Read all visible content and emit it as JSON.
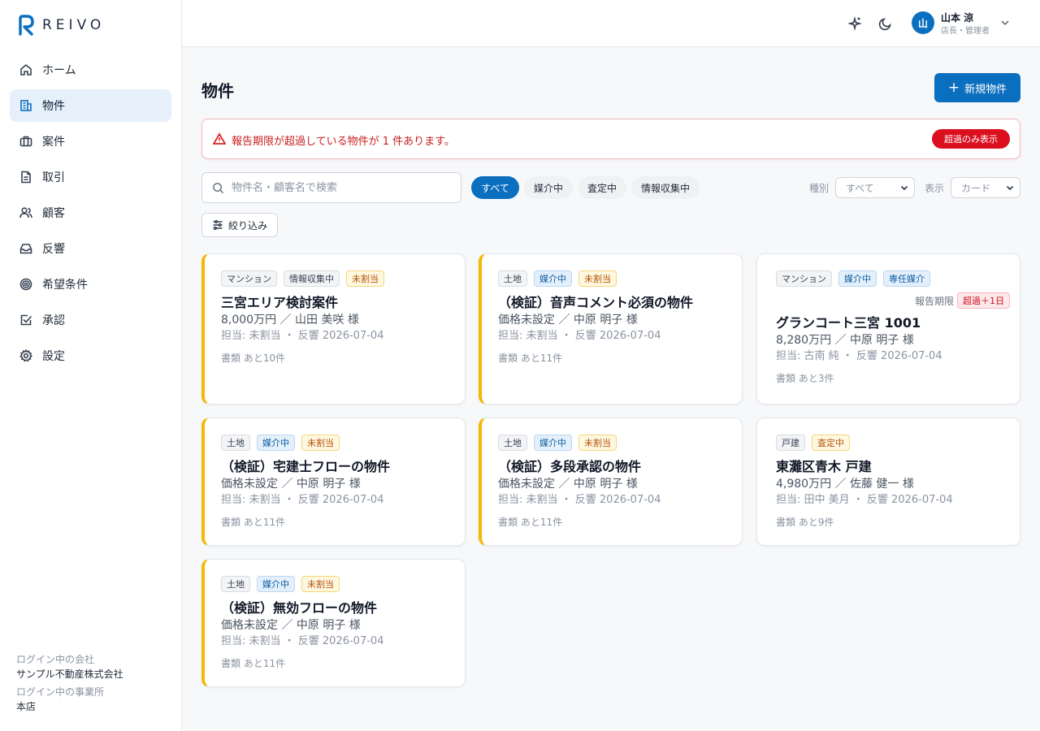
{
  "brand": {
    "name": "REIVO",
    "color": "#0b6fbf"
  },
  "sidebar": {
    "items": [
      {
        "label": "ホーム",
        "icon": "home-icon"
      },
      {
        "label": "物件",
        "icon": "building-icon",
        "active": true
      },
      {
        "label": "案件",
        "icon": "briefcase-icon"
      },
      {
        "label": "取引",
        "icon": "document-icon"
      },
      {
        "label": "顧客",
        "icon": "users-icon"
      },
      {
        "label": "反響",
        "icon": "inbox-icon"
      },
      {
        "label": "希望条件",
        "icon": "target-icon"
      },
      {
        "label": "承認",
        "icon": "check-square-icon"
      },
      {
        "label": "設定",
        "icon": "gear-icon"
      }
    ],
    "footer": {
      "company_label": "ログイン中の会社",
      "company": "サンプル不動産株式会社",
      "office_label": "ログイン中の事業所",
      "office": "本店"
    }
  },
  "header": {
    "user": {
      "initial": "山",
      "name": "山本 涼",
      "role": "店長・管理者"
    }
  },
  "page": {
    "title": "物件",
    "new_button": "新規物件"
  },
  "alert": {
    "text": "報告期限が超過している物件が 1 件あります。",
    "button": "超過のみ表示"
  },
  "search": {
    "placeholder": "物件名・顧客名で検索",
    "value": ""
  },
  "status_filters": [
    "すべて",
    "媒介中",
    "査定中",
    "情報収集中"
  ],
  "active_status_filter": "すべて",
  "type_select": {
    "label": "種別",
    "value": "すべて"
  },
  "view_select": {
    "label": "表示",
    "value": "カード"
  },
  "filter_button": "絞り込み",
  "cards": [
    {
      "tags": [
        {
          "text": "マンション",
          "style": "gray"
        },
        {
          "text": "情報収集中",
          "style": "gray"
        },
        {
          "text": "未割当",
          "style": "yellow"
        }
      ],
      "title": "三宮エリア検討案件",
      "price": "8,000万円 ／ 山田 美咲 様",
      "meta": "担当: 未割当 ・ 反響 2026-07-04",
      "docs": "書類 あと10件",
      "warn": true
    },
    {
      "tags": [
        {
          "text": "土地",
          "style": "gray"
        },
        {
          "text": "媒介中",
          "style": "blue"
        },
        {
          "text": "未割当",
          "style": "yellow"
        }
      ],
      "title": "（検証）音声コメント必須の物件",
      "price": "価格未設定 ／ 中原 明子 様",
      "meta": "担当: 未割当 ・ 反響 2026-07-04",
      "docs": "書類 あと11件",
      "warn": true
    },
    {
      "tags": [
        {
          "text": "マンション",
          "style": "gray"
        },
        {
          "text": "媒介中",
          "style": "blue"
        },
        {
          "text": "専任媒介",
          "style": "blue"
        }
      ],
      "deadline_label": "報告期限",
      "deadline_badge": "超過＋1日",
      "title": "グランコート三宮 1001",
      "price": "8,280万円 ／ 中原 明子 様",
      "meta": "担当: 古南 純 ・ 反響 2026-07-04",
      "docs": "書類 あと3件",
      "warn": false
    },
    {
      "tags": [
        {
          "text": "土地",
          "style": "gray"
        },
        {
          "text": "媒介中",
          "style": "blue"
        },
        {
          "text": "未割当",
          "style": "yellow"
        }
      ],
      "title": "（検証）宅建士フローの物件",
      "price": "価格未設定 ／ 中原 明子 様",
      "meta": "担当: 未割当 ・ 反響 2026-07-04",
      "docs": "書類 あと11件",
      "warn": true
    },
    {
      "tags": [
        {
          "text": "土地",
          "style": "gray"
        },
        {
          "text": "媒介中",
          "style": "blue"
        },
        {
          "text": "未割当",
          "style": "yellow"
        }
      ],
      "title": "（検証）多段承認の物件",
      "price": "価格未設定 ／ 中原 明子 様",
      "meta": "担当: 未割当 ・ 反響 2026-07-04",
      "docs": "書類 あと11件",
      "warn": true
    },
    {
      "tags": [
        {
          "text": "戸建",
          "style": "gray"
        },
        {
          "text": "査定中",
          "style": "yellow"
        }
      ],
      "title": "東灘区青木 戸建",
      "price": "4,980万円 ／ 佐藤 健一 様",
      "meta": "担当: 田中 美月 ・ 反響 2026-07-04",
      "docs": "書類 あと9件",
      "warn": false
    },
    {
      "tags": [
        {
          "text": "土地",
          "style": "gray"
        },
        {
          "text": "媒介中",
          "style": "blue"
        },
        {
          "text": "未割当",
          "style": "yellow"
        }
      ],
      "title": "（検証）無効フローの物件",
      "price": "価格未設定 ／ 中原 明子 様",
      "meta": "担当: 未割当 ・ 反響 2026-07-04",
      "docs": "書類 あと11件",
      "warn": true
    }
  ]
}
